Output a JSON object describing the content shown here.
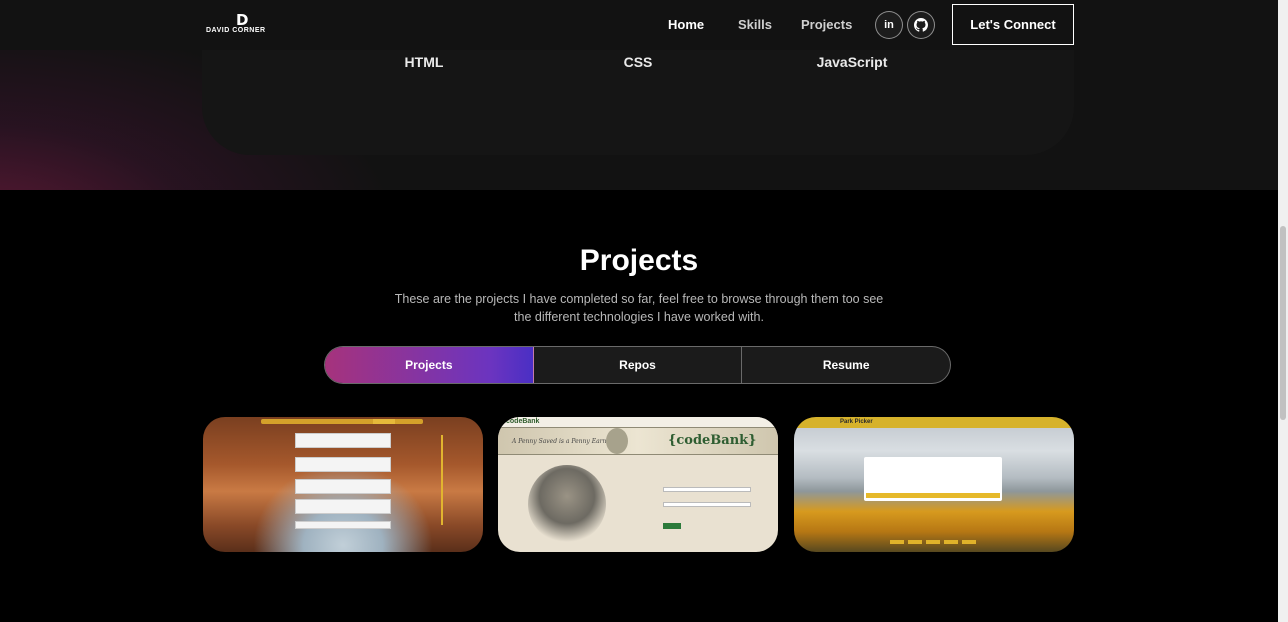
{
  "navbar": {
    "logo_initial": "D",
    "logo_name": "DAVID CORNER",
    "links": [
      "Home",
      "Skills",
      "Projects"
    ],
    "social": [
      {
        "icon": "linkedin-icon",
        "glyph": "in"
      },
      {
        "icon": "github-icon",
        "glyph": "⌥"
      }
    ],
    "connect_label": "Let's Connect"
  },
  "skills": {
    "items": [
      "HTML",
      "CSS",
      "JavaScript"
    ],
    "prev_glyph": "‹",
    "next_glyph": "›",
    "ring_color": "#8a2fb3"
  },
  "projects": {
    "title": "Projects",
    "description": "These are the projects I have completed so far, feel free to browse through them too see the different technologies I have worked with.",
    "tabs": [
      "Projects",
      "Repos",
      "Resume"
    ],
    "active_tab": "Projects",
    "cards": {
      "codebank_header": "codeBank",
      "codebank_logo": "{codeBank}",
      "codebank_motto": "A Penny Saved is a Penny Earned",
      "park_title": "Park Picker"
    }
  },
  "colors": {
    "accent_start": "#a6337c",
    "accent_end": "#4a2fc4",
    "background": "#000000"
  }
}
